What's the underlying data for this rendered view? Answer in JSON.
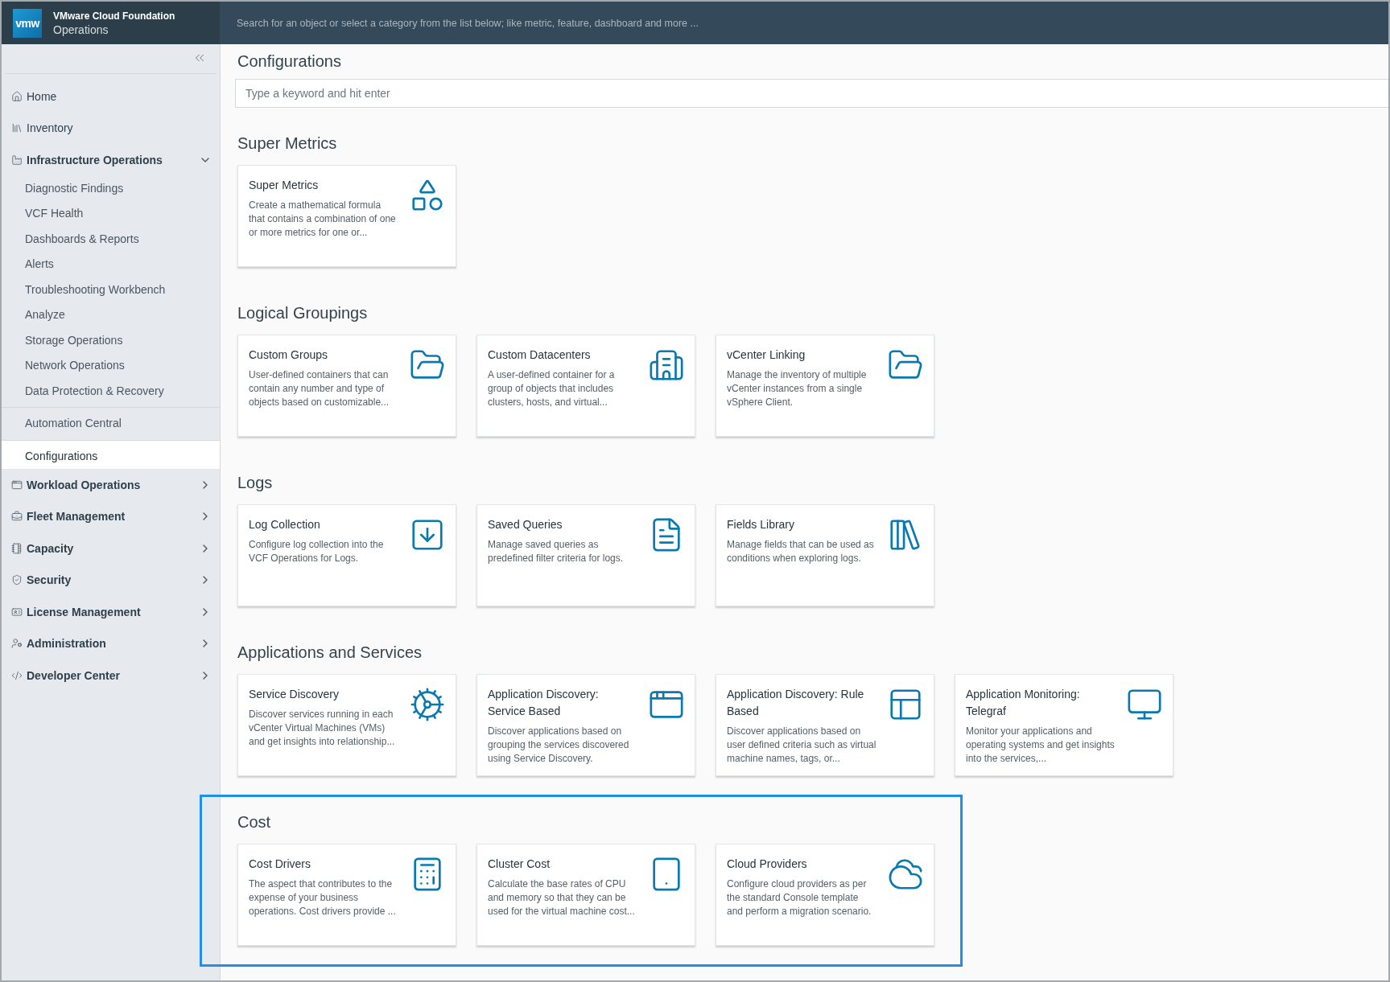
{
  "header": {
    "logo": "vmw",
    "product": "VMware Cloud Foundation",
    "subtitle": "Operations",
    "search": {
      "placeholder": "Search for an object or select a category from the list below; like metric, feature, dashboard and more ..."
    }
  },
  "sidebar": {
    "items": [
      {
        "kind": "link",
        "label": "Home",
        "selected": false
      },
      {
        "kind": "link",
        "label": "Inventory",
        "selected": false
      },
      {
        "kind": "group",
        "label": "Infrastructure Operations",
        "expanded": true,
        "children": [
          {
            "label": "Diagnostic Findings",
            "selected": false,
            "divider_before": false
          },
          {
            "label": "VCF Health",
            "selected": false,
            "divider_before": false
          },
          {
            "label": "Dashboards & Reports",
            "selected": false,
            "divider_before": false
          },
          {
            "label": "Alerts",
            "selected": false,
            "divider_before": false
          },
          {
            "label": "Troubleshooting Workbench",
            "selected": false,
            "divider_before": false
          },
          {
            "label": "Analyze",
            "selected": false,
            "divider_before": false
          },
          {
            "label": "Storage Operations",
            "selected": false,
            "divider_before": false
          },
          {
            "label": "Network Operations",
            "selected": false,
            "divider_before": false
          },
          {
            "label": "Data Protection & Recovery",
            "selected": false,
            "divider_before": false
          },
          {
            "label": "Automation Central",
            "selected": false,
            "divider_before": true
          },
          {
            "label": "Configurations",
            "selected": true,
            "divider_before": true
          }
        ]
      },
      {
        "kind": "group",
        "label": "Workload Operations",
        "expanded": false
      },
      {
        "kind": "group",
        "label": "Fleet Management",
        "expanded": false
      },
      {
        "kind": "group",
        "label": "Capacity",
        "expanded": false
      },
      {
        "kind": "group",
        "label": "Security",
        "expanded": false
      },
      {
        "kind": "group",
        "label": "License Management",
        "expanded": false
      },
      {
        "kind": "group",
        "label": "Administration",
        "expanded": false
      },
      {
        "kind": "group",
        "label": "Developer Center",
        "expanded": false
      }
    ]
  },
  "page": {
    "title": "Configurations",
    "filter": {
      "placeholder": "Type a keyword and hit enter"
    },
    "sections": [
      {
        "title": "Super Metrics",
        "highlighted": false,
        "cards": [
          {
            "title": "Super Metrics",
            "description": "Create a mathematical formula that contains a combination of one or more metrics for one or..."
          }
        ]
      },
      {
        "title": "Logical Groupings",
        "highlighted": false,
        "cards": [
          {
            "title": "Custom Groups",
            "description": "User-defined containers that can contain any number and type of objects based on customizable..."
          },
          {
            "title": "Custom Datacenters",
            "description": "A user-defined container for a group of objects that includes clusters, hosts, and virtual..."
          },
          {
            "title": "vCenter Linking",
            "description": "Manage the inventory of multiple vCenter instances from a single vSphere Client."
          }
        ]
      },
      {
        "title": "Logs",
        "highlighted": false,
        "cards": [
          {
            "title": "Log Collection",
            "description": "Configure log collection into the VCF Operations for Logs."
          },
          {
            "title": "Saved Queries",
            "description": "Manage saved queries as predefined filter criteria for logs."
          },
          {
            "title": "Fields Library",
            "description": "Manage fields that can be used as conditions when exploring logs."
          }
        ]
      },
      {
        "title": "Applications and Services",
        "highlighted": false,
        "cards": [
          {
            "title": "Service Discovery",
            "description": "Discover services running in each vCenter Virtual Machines (VMs) and get insights into relationship..."
          },
          {
            "title": "Application Discovery: Service Based",
            "description": "Discover applications based on grouping the services discovered using Service Discovery."
          },
          {
            "title": "Application Discovery: Rule Based",
            "description": "Discover applications based on user defined criteria such as virtual machine names, tags, or..."
          },
          {
            "title": "Application Monitoring: Telegraf",
            "description": "Monitor your applications and operating systems and get insights into the services,..."
          }
        ]
      },
      {
        "title": "Cost",
        "highlighted": true,
        "cards": [
          {
            "title": "Cost Drivers",
            "description": "The aspect that contributes to the expense of your business operations. Cost drivers provide ..."
          },
          {
            "title": "Cluster Cost",
            "description": "Calculate the base rates of CPU and memory so that they can be used for the virtual machine cost..."
          },
          {
            "title": "Cloud Providers",
            "description": "Configure cloud providers as per the standard Console template and perform a migration scenario."
          }
        ]
      }
    ]
  }
}
